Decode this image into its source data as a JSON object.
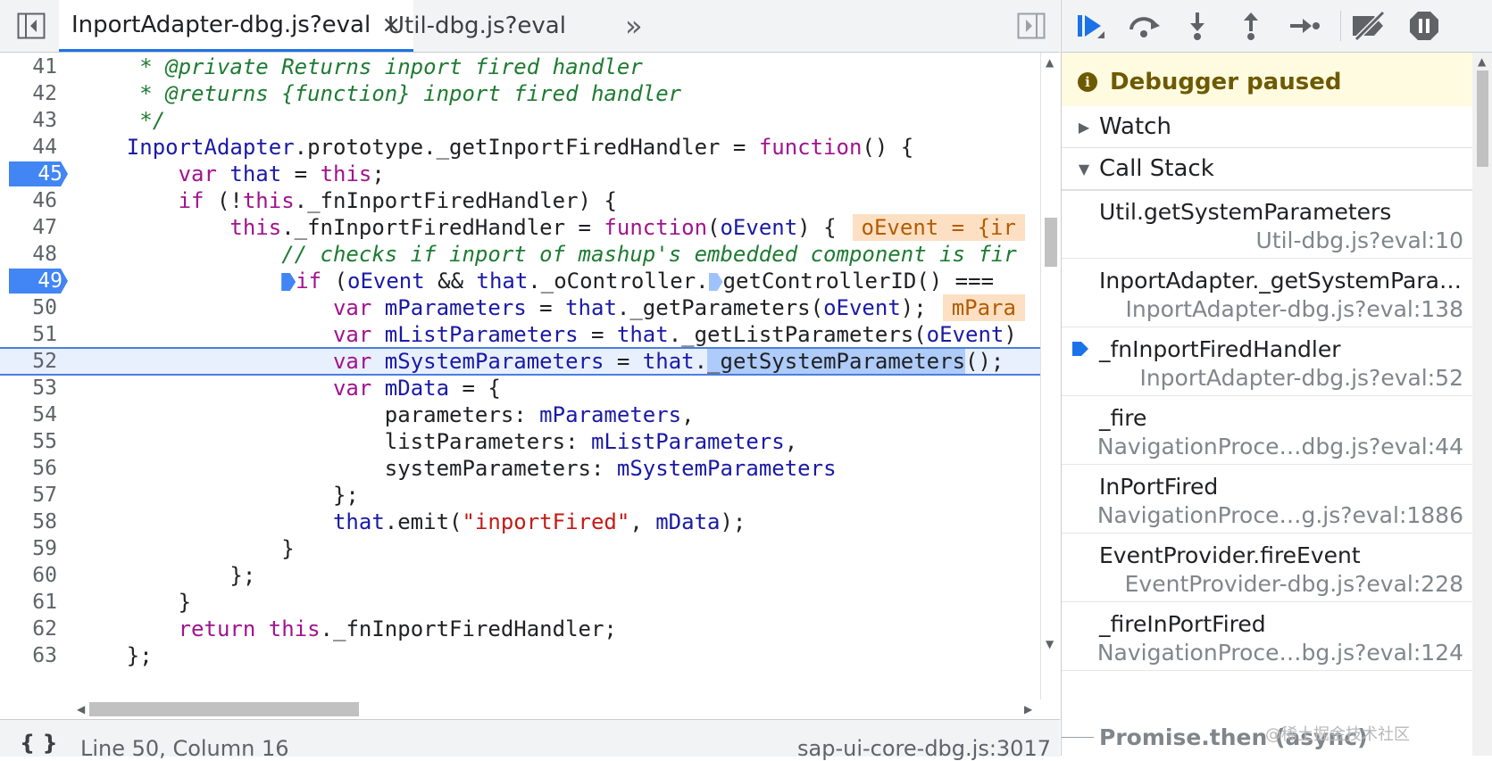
{
  "tabs": {
    "active": {
      "label": "InportAdapter-dbg.js?eval",
      "close": "×"
    },
    "other": {
      "label": "Util-dbg.js?eval"
    },
    "more": "»"
  },
  "code_lines": [
    {
      "n": "41"
    },
    {
      "n": "42"
    },
    {
      "n": "43"
    },
    {
      "n": "44"
    },
    {
      "n": "45"
    },
    {
      "n": "46"
    },
    {
      "n": "47"
    },
    {
      "n": "48"
    },
    {
      "n": "49"
    },
    {
      "n": "50"
    },
    {
      "n": "51"
    },
    {
      "n": "52"
    },
    {
      "n": "53"
    },
    {
      "n": "54"
    },
    {
      "n": "55"
    },
    {
      "n": "56"
    },
    {
      "n": "57"
    },
    {
      "n": "58"
    },
    {
      "n": "59"
    },
    {
      "n": "60"
    },
    {
      "n": "61"
    },
    {
      "n": "62"
    },
    {
      "n": "63"
    }
  ],
  "code": {
    "l41": "     * @private Returns inport fired handler",
    "l42": "     * @returns {function} inport fired handler",
    "l43": "     */",
    "l44_a": "    InportAdapter",
    "l44_b": ".prototype._getInportFiredHandler = ",
    "l44_c": "function",
    "l44_d": "() {",
    "l45_a": "        ",
    "l45_b": "var",
    "l45_c": " that",
    "l45_d": " = ",
    "l45_e": "this",
    "l45_f": ";",
    "l46_a": "        ",
    "l46_b": "if",
    "l46_c": " (!",
    "l46_d": "this",
    "l46_e": "._fnInportFiredHandler) {",
    "l47_a": "            ",
    "l47_b": "this",
    "l47_c": "._fnInportFiredHandler = ",
    "l47_d": "function",
    "l47_e": "(",
    "l47_f": "oEvent",
    "l47_g": ") {",
    "l47_val": "oEvent = {ir",
    "l48_a": "                ",
    "l48_b": "// checks if inport of mashup's embedded component is fir",
    "l49_a": "                ",
    "l49_b": "if",
    "l49_c": " (",
    "l49_d": "oEvent",
    "l49_e": " && ",
    "l49_f": "that",
    "l49_g": "._oController.",
    "l49_h": "getControllerID() ===",
    "l50_a": "                    ",
    "l50_b": "var",
    "l50_c": " mParameters",
    "l50_d": " = ",
    "l50_e": "that",
    "l50_f": "._getParameters(",
    "l50_g": "oEvent",
    "l50_h": ");",
    "l50_val": "mPara",
    "l51_a": "                    ",
    "l51_b": "var",
    "l51_c": " mListParameters",
    "l51_d": " = ",
    "l51_e": "that",
    "l51_f": "._getListParameters(",
    "l51_g": "oEvent",
    "l51_h": ")",
    "l52_a": "                    ",
    "l52_b": "var",
    "l52_c": " mSystemParameters",
    "l52_d": " = ",
    "l52_e": "that",
    "l52_f": ".",
    "l52_g": "_getSystemParameters",
    "l52_h": "();",
    "l53_a": "                    ",
    "l53_b": "var",
    "l53_c": " mData",
    "l53_d": " = {",
    "l54_a": "                        parameters: ",
    "l54_b": "mParameters",
    "l54_c": ",",
    "l55_a": "                        listParameters: ",
    "l55_b": "mListParameters",
    "l55_c": ",",
    "l56_a": "                        systemParameters: ",
    "l56_b": "mSystemParameters",
    "l57": "                    };",
    "l58_a": "                    ",
    "l58_b": "that",
    "l58_c": ".emit(",
    "l58_d": "\"inportFired\"",
    "l58_e": ", ",
    "l58_f": "mData",
    "l58_g": ");",
    "l59": "                }",
    "l60": "            };",
    "l61": "        }",
    "l62_a": "        ",
    "l62_b": "return",
    "l62_c": " ",
    "l62_d": "this",
    "l62_e": "._fnInportFiredHandler;",
    "l63": "    };"
  },
  "status": {
    "braces": "{ }",
    "position": "Line 50, Column 16",
    "source": "sap-ui-core-dbg.js:3017"
  },
  "debugger": {
    "paused_text": "Debugger paused",
    "watch_label": "Watch",
    "callstack_label": "Call Stack",
    "frames": [
      {
        "fn": "Util.getSystemParameters",
        "loc": "Util-dbg.js?eval:10"
      },
      {
        "fn": "InportAdapter._getSystemPara…",
        "loc": "InportAdapter-dbg.js?eval:138"
      },
      {
        "fn": "_fnInportFiredHandler",
        "loc": "InportAdapter-dbg.js?eval:52"
      },
      {
        "fn": "_fire",
        "loc": "NavigationProce…dbg.js?eval:44"
      },
      {
        "fn": "InPortFired",
        "loc": "NavigationProce…g.js?eval:1886"
      },
      {
        "fn": "EventProvider.fireEvent",
        "loc": "EventProvider-dbg.js?eval:228"
      },
      {
        "fn": "_fireInPortFired",
        "loc": "NavigationProce…bg.js?eval:124"
      }
    ],
    "promise_label": "Promise.then (async)"
  },
  "watermark": "@稀土掘金技术社区",
  "colors": {
    "accent": "#1a73e8",
    "breakpoint": "#4285f4",
    "paused_bg": "#fffbe0"
  }
}
